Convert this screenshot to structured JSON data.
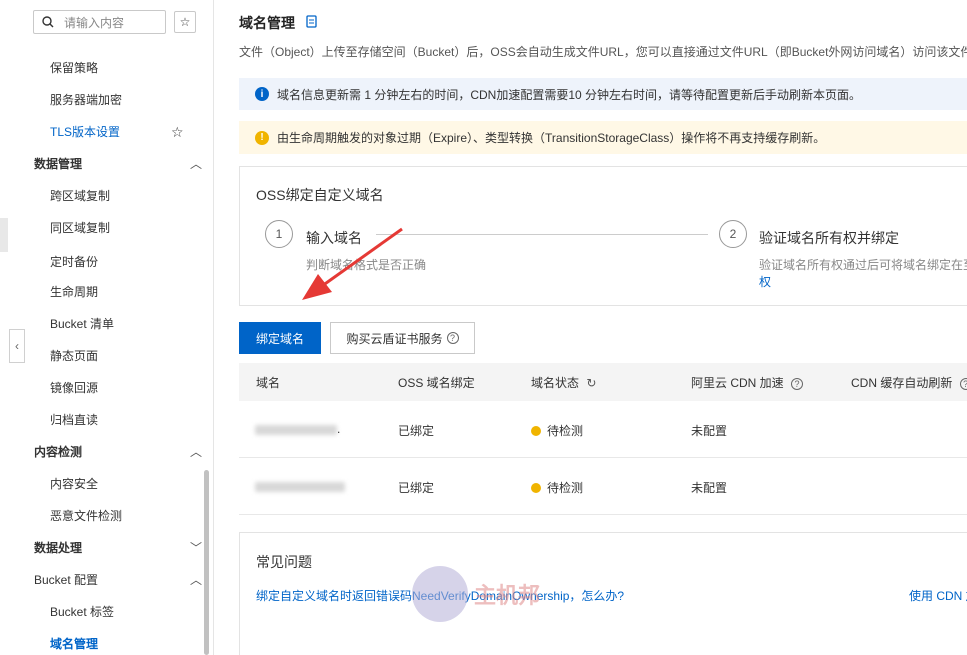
{
  "sidebar": {
    "search_placeholder": "请输入内容",
    "items": [
      {
        "label": "保留策略"
      },
      {
        "label": "服务器端加密"
      },
      {
        "label": "TLS版本设置"
      },
      {
        "label": "数据管理"
      },
      {
        "label": "跨区域复制"
      },
      {
        "label": "同区域复制"
      },
      {
        "label": "定时备份"
      },
      {
        "label": "生命周期"
      },
      {
        "label": "Bucket 清单"
      },
      {
        "label": "静态页面"
      },
      {
        "label": "镜像回源"
      },
      {
        "label": "归档直读"
      },
      {
        "label": "内容检测"
      },
      {
        "label": "内容安全"
      },
      {
        "label": "恶意文件检测"
      },
      {
        "label": "数据处理"
      },
      {
        "label": "Bucket 配置"
      },
      {
        "label": "Bucket 标签"
      },
      {
        "label": "域名管理"
      }
    ]
  },
  "page": {
    "title": "域名管理",
    "description": "文件（Object）上传至存储空间（Bucket）后，OSS会自动生成文件URL，您可以直接通过文件URL（即Bucket外网访问域名）访问该文件。",
    "info_alert": "域名信息更新需 1 分钟左右的时间，CDN加速配置需要10 分钟左右时间，请等待配置更新后手动刷新本页面。",
    "warn_alert": "由生命周期触发的对象过期（Expire）、类型转换（TransitionStorageClass）操作将不再支持缓存刷新。"
  },
  "card": {
    "title": "OSS绑定自定义域名",
    "step1": {
      "num": "1",
      "title": "输入域名",
      "sub": "判断域名格式是否正确"
    },
    "step2": {
      "num": "2",
      "title": "验证域名所有权并绑定",
      "sub": "验证域名所有权通过后可将域名绑定在至",
      "sub2": "权"
    }
  },
  "buttons": {
    "bind": "绑定域名",
    "buy_cert": "购买云盾证书服务"
  },
  "table": {
    "headers": [
      "域名",
      "OSS 域名绑定",
      "域名状态",
      "阿里云 CDN 加速",
      "CDN 缓存自动刷新"
    ],
    "rows": [
      {
        "domain_suffix": ".",
        "bind": "已绑定",
        "status": "待检测",
        "cdn": "未配置"
      },
      {
        "domain_suffix": "",
        "bind": "已绑定",
        "status": "待检测",
        "cdn": "未配置"
      }
    ]
  },
  "faq": {
    "title": "常见问题",
    "link1": "绑定自定义域名时返回错误码NeedVerifyDomainOwnership，怎么办?",
    "link2": "使用 CDN 加"
  },
  "watermark": {
    "text": "主机邦"
  },
  "colors": {
    "accent": "#0064c8",
    "warn": "#f0b400",
    "arrow": "#e53935"
  }
}
